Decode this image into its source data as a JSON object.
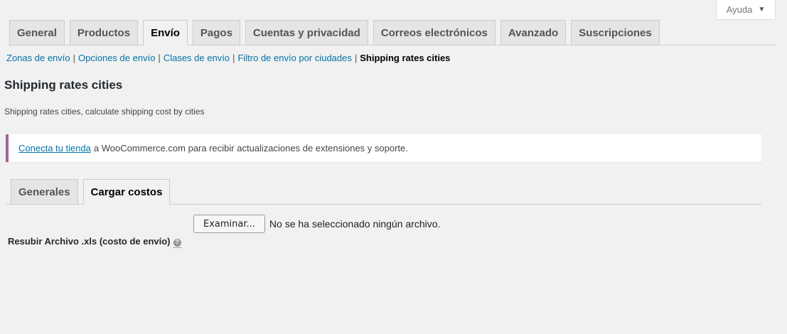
{
  "help": {
    "label": "Ayuda",
    "caret": "▼"
  },
  "nav_tabs": [
    {
      "label": "General"
    },
    {
      "label": "Productos"
    },
    {
      "label": "Envío"
    },
    {
      "label": "Pagos"
    },
    {
      "label": "Cuentas y privacidad"
    },
    {
      "label": "Correos electrónicos"
    },
    {
      "label": "Avanzado"
    },
    {
      "label": "Suscripciones"
    }
  ],
  "subnav": {
    "items": [
      "Zonas de envío",
      "Opciones de envío",
      "Clases de envío",
      "Filtro de envío por ciudades"
    ],
    "separator": "|",
    "current": "Shipping rates cities"
  },
  "page": {
    "title": "Shipping rates cities",
    "description": "Shipping rates cities, calculate shipping cost by cities"
  },
  "notice": {
    "link": "Conecta tu tienda",
    "text": "a WooCommerce.com para recibir actualizaciones de extensiones y soporte."
  },
  "inner_tabs": [
    {
      "label": "Generales"
    },
    {
      "label": "Cargar costos"
    }
  ],
  "form": {
    "label": "Resubir Archivo .xls (costo de envío)",
    "help_icon": "?",
    "button": "Examinar...",
    "status": "No se ha seleccionado ningún archivo."
  },
  "colors": {
    "link": "#0073aa",
    "notice_border": "#a2619f",
    "background": "#f1f1f1"
  }
}
